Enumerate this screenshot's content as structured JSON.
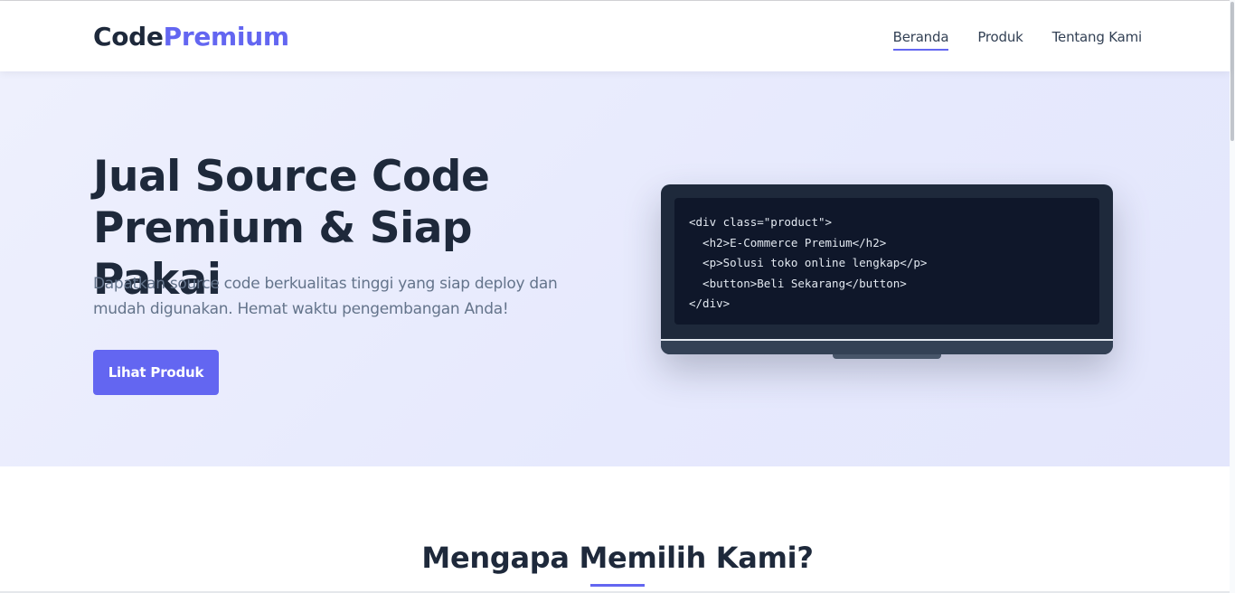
{
  "brand": {
    "part1": "Code",
    "part2": "Premium"
  },
  "nav": {
    "items": [
      {
        "label": "Beranda",
        "active": true
      },
      {
        "label": "Produk",
        "active": false
      },
      {
        "label": "Tentang Kami",
        "active": false
      }
    ]
  },
  "hero": {
    "title_line1": "Jual Source Code",
    "title_line2": "Premium & Siap Pakai",
    "description": "Dapatkan source code berkualitas tinggi yang siap deploy dan mudah digunakan. Hemat waktu pengembangan Anda!",
    "button_label": "Lihat Produk"
  },
  "code_preview": {
    "lines": [
      "<div class=\"product\">",
      "  <h2>E-Commerce Premium</h2>",
      "  <p>Solusi toko online lengkap</p>",
      "  <button>Beli Sekarang</button>",
      "</div>"
    ]
  },
  "features": {
    "title": "Mengapa Memilih Kami?"
  },
  "colors": {
    "accent": "#6366f1",
    "text_dark": "#1e293b",
    "text_muted": "#64748b",
    "hero_bg": "#eef0fd",
    "laptop_frame": "#1e293b",
    "laptop_screen": "#0f172a"
  }
}
